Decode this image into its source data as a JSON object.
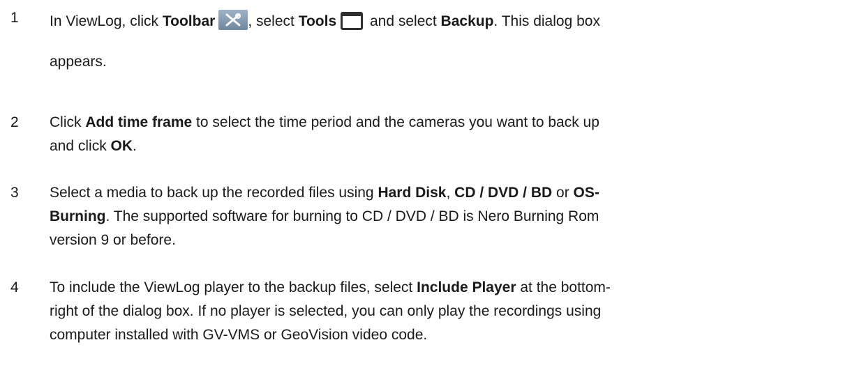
{
  "steps": [
    {
      "num": "1",
      "line1": {
        "t1": "In ViewLog, click ",
        "b1": "Toolbar",
        "t2": ", select ",
        "b2": "Tools",
        "t3": " and select ",
        "b3": "Backup",
        "t4": ". This dialog box"
      },
      "line2": "appears."
    },
    {
      "num": "2",
      "line1": {
        "t1": "Click ",
        "b1": "Add time frame",
        "t2": " to select the time period and the cameras you want to back up"
      },
      "line2": {
        "t1": "and click ",
        "b1": "OK",
        "t2": "."
      }
    },
    {
      "num": "3",
      "line1": {
        "t1": "Select a media to back up the recorded files using ",
        "b1": "Hard Disk",
        "t2": ", ",
        "b2": "CD / DVD / BD",
        "t3": " or ",
        "b3": "OS-"
      },
      "line2": {
        "b1": "Burning",
        "t1": ". The supported software for burning to CD / DVD / BD is Nero Burning Rom"
      },
      "line3": "version 9 or before."
    },
    {
      "num": "4",
      "line1": {
        "t1": "To include the ViewLog player to the backup files, select ",
        "b1": "Include Player",
        "t2": " at the bottom-"
      },
      "line2": "right of the dialog box. If no player is selected, you can only play the recordings using",
      "line3": "computer installed with GV-VMS or GeoVision video code."
    }
  ],
  "icons": {
    "toolbar_icon": "wrench-screwdriver-icon",
    "tools_icon": "window-icon"
  }
}
